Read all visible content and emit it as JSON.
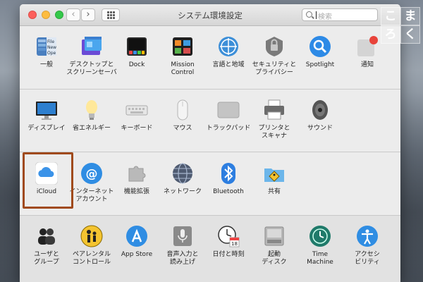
{
  "window": {
    "title": "システム環境設定",
    "search_placeholder": "検索",
    "nav_back": "‹",
    "nav_forward": "›"
  },
  "sections": [
    [
      {
        "label": "一般",
        "icon": "general-icon"
      },
      {
        "label": "デスクトップと\nスクリーンセーバ",
        "icon": "desktop-screensaver-icon"
      },
      {
        "label": "Dock",
        "icon": "dock-icon"
      },
      {
        "label": "Mission\nControl",
        "icon": "mission-control-icon"
      },
      {
        "label": "言語と地域",
        "icon": "language-region-icon"
      },
      {
        "label": "セキュリティと\nプライバシー",
        "icon": "security-privacy-icon"
      },
      {
        "label": "Spotlight",
        "icon": "spotlight-icon"
      },
      {
        "label": "通知",
        "icon": "notifications-icon"
      }
    ],
    [
      {
        "label": "ディスプレイ",
        "icon": "displays-icon"
      },
      {
        "label": "省エネルギー",
        "icon": "energy-saver-icon"
      },
      {
        "label": "キーボード",
        "icon": "keyboard-icon"
      },
      {
        "label": "マウス",
        "icon": "mouse-icon"
      },
      {
        "label": "トラックパッド",
        "icon": "trackpad-icon"
      },
      {
        "label": "プリンタと\nスキャナ",
        "icon": "printers-scanners-icon"
      },
      {
        "label": "サウンド",
        "icon": "sound-icon"
      }
    ],
    [
      {
        "label": "iCloud",
        "icon": "icloud-icon"
      },
      {
        "label": "インターネット\nアカウント",
        "icon": "internet-accounts-icon"
      },
      {
        "label": "機能拡張",
        "icon": "extensions-icon"
      },
      {
        "label": "ネットワーク",
        "icon": "network-icon"
      },
      {
        "label": "Bluetooth",
        "icon": "bluetooth-icon"
      },
      {
        "label": "共有",
        "icon": "sharing-icon"
      }
    ],
    [
      {
        "label": "ユーザと\nグループ",
        "icon": "users-groups-icon"
      },
      {
        "label": "ペアレンタル\nコントロール",
        "icon": "parental-controls-icon"
      },
      {
        "label": "App Store",
        "icon": "app-store-icon"
      },
      {
        "label": "音声入力と\n読み上げ",
        "icon": "dictation-speech-icon"
      },
      {
        "label": "日付と時刻",
        "icon": "date-time-icon"
      },
      {
        "label": "起動\nディスク",
        "icon": "startup-disk-icon"
      },
      {
        "label": "Time\nMachine",
        "icon": "time-machine-icon"
      },
      {
        "label": "アクセシ\nビリティ",
        "icon": "accessibility-icon"
      }
    ]
  ],
  "stamp": {
    "chars": [
      "こ",
      "ま",
      "ろ",
      "く"
    ]
  },
  "colors": {
    "highlight_border": "#a04a1c",
    "close": "#fc605c",
    "minimize": "#fdbc40",
    "zoom": "#34c84a"
  }
}
